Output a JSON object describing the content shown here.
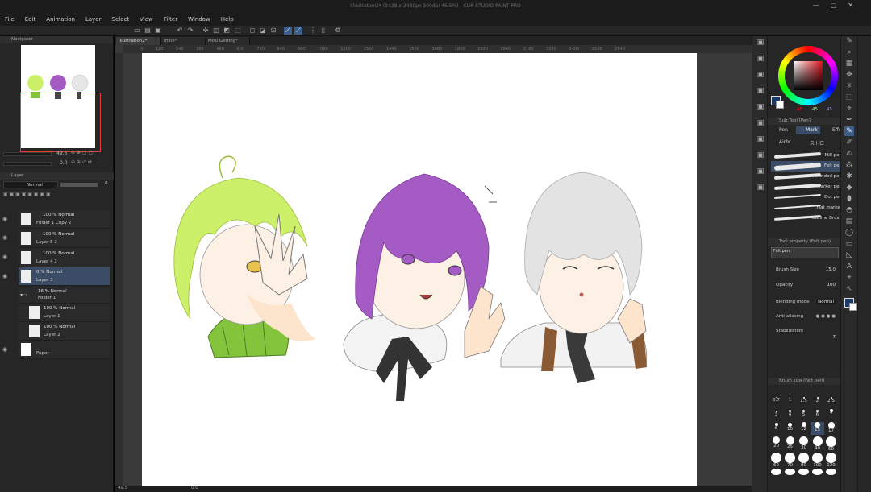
{
  "window": {
    "title": "Illustration2* (3428 x 2480px 300dpi 46.5%) - CLIP STUDIO PAINT PRO"
  },
  "menu": [
    "File",
    "Edit",
    "Animation",
    "Layer",
    "Select",
    "View",
    "Filter",
    "Window",
    "Help"
  ],
  "tabs": [
    "Illustration2*",
    "mine*",
    "Miru Getting*"
  ],
  "navigator": {
    "title": "Navigator",
    "zoom": "49.5",
    "rotate": "0.0"
  },
  "layer_panel": {
    "title": "Layer",
    "blend_mode": "Normal",
    "opacity": "0",
    "layers": [
      {
        "mode": "100 % Normal",
        "name": "Folder 1 Copy 2"
      },
      {
        "mode": "100 % Normal",
        "name": "Layer 5 2"
      },
      {
        "mode": "100 % Normal",
        "name": "Layer 4 2"
      },
      {
        "mode": "0 % Normal",
        "name": "Layer 3"
      },
      {
        "mode": "16 % Normal",
        "name": "Folder 1"
      },
      {
        "mode": "100 % Normal",
        "name": "Layer 1"
      },
      {
        "mode": "100 % Normal",
        "name": "Layer 2"
      },
      {
        "mode": "",
        "name": "Paper"
      }
    ]
  },
  "ruler": {
    "ticks": [
      "0",
      "120",
      "240",
      "360",
      "480",
      "600",
      "720",
      "840",
      "960",
      "1080",
      "1200",
      "1320",
      "1440",
      "1560",
      "1680",
      "1800",
      "1920",
      "2040",
      "2160",
      "2280",
      "2400",
      "2520",
      "2640"
    ]
  },
  "status": {
    "zoom": "49.5",
    "rotate": "0.0"
  },
  "color": {
    "values": [
      "45",
      "45",
      "45"
    ],
    "accent": "#e0141e"
  },
  "subtool": {
    "title": "Sub Tool [Pen]",
    "tabs": [
      "Pen",
      "Mark",
      "Effect"
    ],
    "extra_tabs": [
      "Airbr",
      "ストロ"
    ],
    "brushes": [
      "Mill pen",
      "Felt pen",
      "Rounded pen",
      "Marker pen",
      "Dot pen",
      "Flat marker",
      "Outline Brush"
    ]
  },
  "tool_property": {
    "title": "Tool property (Felt pen)",
    "preset": "Felt pen",
    "brush_size_label": "Brush Size",
    "brush_size": "15.0",
    "opacity_label": "Opacity",
    "opacity": "100",
    "blending_label": "Blending mode",
    "blending": "Normal",
    "antialias_label": "Anti-aliasing",
    "stabilization_label": "Stabilization",
    "stabilization": "7"
  },
  "brush_size_panel": {
    "title": "Brush size (Felt pen)",
    "sizes": [
      "0.7",
      "1",
      "1.5",
      "2",
      "2.5",
      "3",
      "4",
      "5",
      "6",
      "7",
      "8",
      "10",
      "12",
      "15",
      "17",
      "20",
      "25",
      "30",
      "40",
      "50",
      "60",
      "70",
      "80",
      "100",
      "120",
      "150",
      "170",
      "200",
      "250",
      "300"
    ]
  },
  "artwork": {
    "characters": [
      "green-haired-boy",
      "purple-haired-girl",
      "white-haired-boy"
    ],
    "colors": {
      "green": "#cdf06a",
      "purple": "#a45bc4",
      "gray": "#e3e3e3",
      "skin": "#fce4cf",
      "shirt_green": "#84c43c",
      "tie": "#3a3a3a",
      "brown": "#8a5a35"
    }
  }
}
